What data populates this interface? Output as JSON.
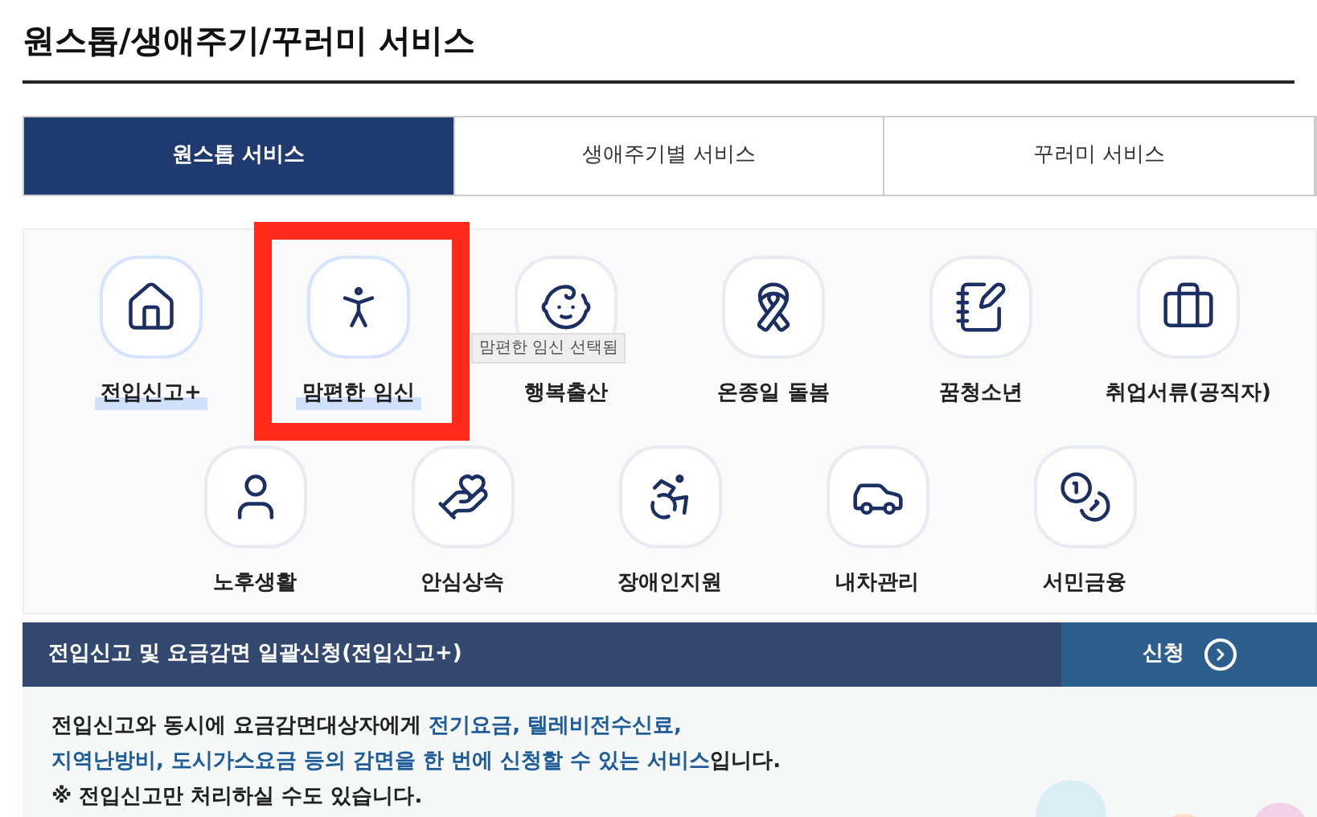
{
  "page_title": "원스톱/생애주기/꾸러미 서비스",
  "tabs": [
    {
      "label": "원스톱 서비스",
      "selected": true
    },
    {
      "label": "생애주기별 서비스",
      "selected": false
    },
    {
      "label": "꾸러미 서비스",
      "selected": false
    }
  ],
  "services": [
    {
      "label": "전입신고+",
      "selected": true
    },
    {
      "label": "맘편한 임신",
      "selected": true
    },
    {
      "label": "행복출산",
      "selected": false
    },
    {
      "label": "온종일 돌봄",
      "selected": false
    },
    {
      "label": "꿈청소년",
      "selected": false
    },
    {
      "label": "취업서류(공직자)",
      "selected": false
    },
    {
      "label": "노후생활",
      "selected": false
    },
    {
      "label": "안심상속",
      "selected": false
    },
    {
      "label": "장애인지원",
      "selected": false
    },
    {
      "label": "내차관리",
      "selected": false
    },
    {
      "label": "서민금융",
      "selected": false
    }
  ],
  "tooltip": "맘편한 임신 선택됨",
  "banner": {
    "title": "전입신고 및 요금감면 일괄신청(전입신고+)",
    "button": "신청"
  },
  "description": [
    [
      {
        "kind": "plain",
        "text": "전입신고와 동시에 요금감면대상자에게 "
      },
      {
        "kind": "highlight",
        "text": "전기요금, 텔레비전수신료,"
      }
    ],
    [
      {
        "kind": "highlight",
        "text": "지역난방비, 도시가스요금 등의 감면을 한 번에 신청할 수 있는 서비스"
      },
      {
        "kind": "plain",
        "text": "입니다."
      }
    ],
    [
      {
        "kind": "plain",
        "text": "※ 전입신고만 처리하실 수도 있습니다."
      }
    ]
  ]
}
